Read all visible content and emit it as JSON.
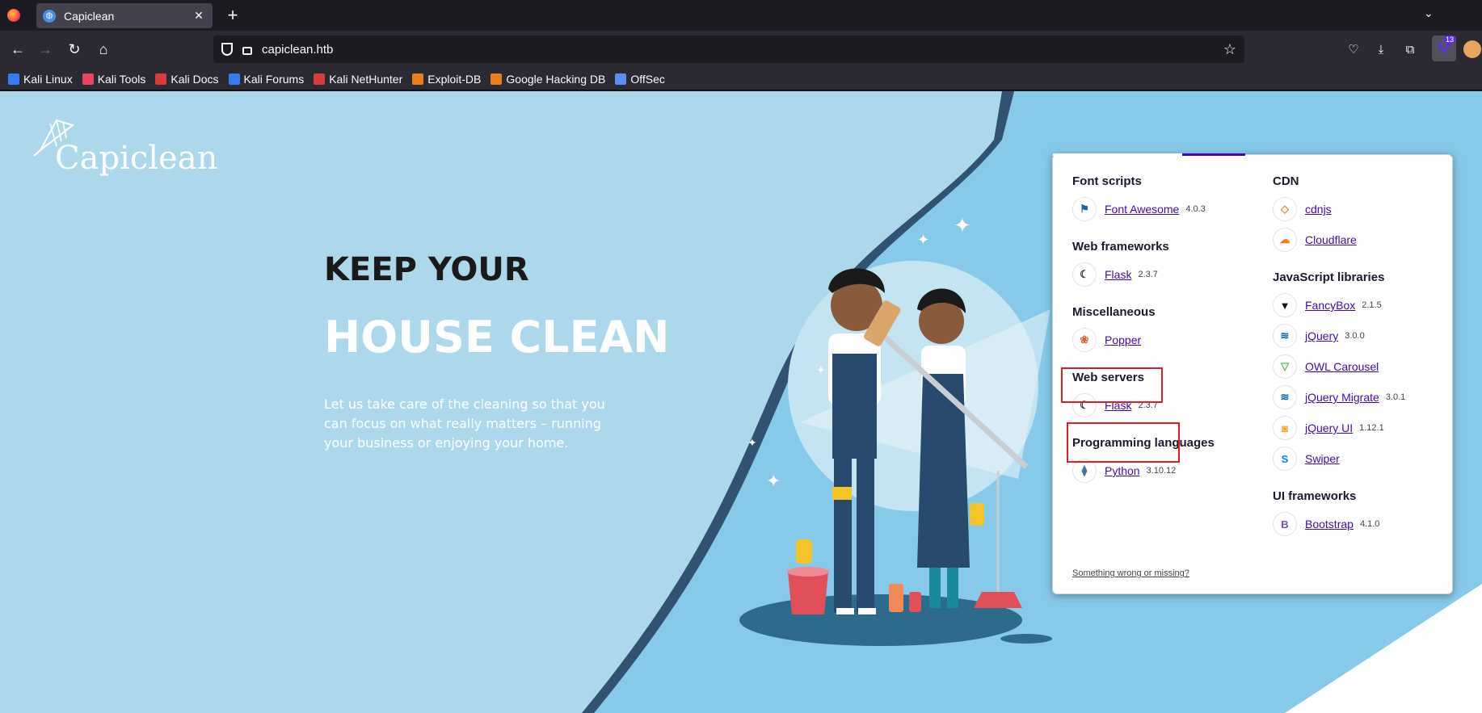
{
  "browser": {
    "tab_title": "Capiclean",
    "url": "capiclean.htb",
    "extension_badge": "13",
    "bookmarks": [
      {
        "label": "Kali Linux",
        "color": "#367bf0"
      },
      {
        "label": "Kali Tools",
        "color": "#e94560"
      },
      {
        "label": "Kali Docs",
        "color": "#d63c3c"
      },
      {
        "label": "Kali Forums",
        "color": "#367bf0"
      },
      {
        "label": "Kali NetHunter",
        "color": "#d63c3c"
      },
      {
        "label": "Exploit-DB",
        "color": "#e67e22"
      },
      {
        "label": "Google Hacking DB",
        "color": "#e67e22"
      },
      {
        "label": "OffSec",
        "color": "#5b8def"
      }
    ]
  },
  "page": {
    "brand": "Capiclean",
    "headline_1": "KEEP YOUR",
    "headline_2": "HOUSE CLEAN",
    "tagline": "Let us take care of the cleaning so that you can focus on what really matters – running your business or enjoying your home."
  },
  "wappalyzer": {
    "left": [
      {
        "category": "Font scripts",
        "items": [
          {
            "name": "Font Awesome",
            "version": "4.0.3",
            "icon": "flag-icon"
          }
        ]
      },
      {
        "category": "Web frameworks",
        "items": [
          {
            "name": "Flask",
            "version": "2.3.7",
            "icon": "flask-icon"
          }
        ]
      },
      {
        "category": "Miscellaneous",
        "items": [
          {
            "name": "Popper",
            "version": "",
            "icon": "popper-icon"
          }
        ]
      },
      {
        "category": "Web servers",
        "items": [
          {
            "name": "Flask",
            "version": "2.3.7",
            "icon": "flask-icon"
          }
        ]
      },
      {
        "category": "Programming languages",
        "items": [
          {
            "name": "Python",
            "version": "3.10.12",
            "icon": "python-icon"
          }
        ]
      }
    ],
    "right": [
      {
        "category": "CDN",
        "items": [
          {
            "name": "cdnjs",
            "version": "",
            "icon": "cdnjs-icon"
          },
          {
            "name": "Cloudflare",
            "version": "",
            "icon": "cloudflare-icon"
          }
        ]
      },
      {
        "category": "JavaScript libraries",
        "items": [
          {
            "name": "FancyBox",
            "version": "2.1.5",
            "icon": "fancybox-icon"
          },
          {
            "name": "jQuery",
            "version": "3.0.0",
            "icon": "jquery-icon"
          },
          {
            "name": "OWL Carousel",
            "version": "",
            "icon": "owl-icon"
          },
          {
            "name": "jQuery Migrate",
            "version": "3.0.1",
            "icon": "jquery-icon"
          },
          {
            "name": "jQuery UI",
            "version": "1.12.1",
            "icon": "jqueryui-icon"
          },
          {
            "name": "Swiper",
            "version": "",
            "icon": "swiper-icon"
          }
        ]
      },
      {
        "category": "UI frameworks",
        "items": [
          {
            "name": "Bootstrap",
            "version": "4.1.0",
            "icon": "bootstrap-icon"
          }
        ]
      }
    ],
    "footer": "Something wrong or missing?"
  }
}
